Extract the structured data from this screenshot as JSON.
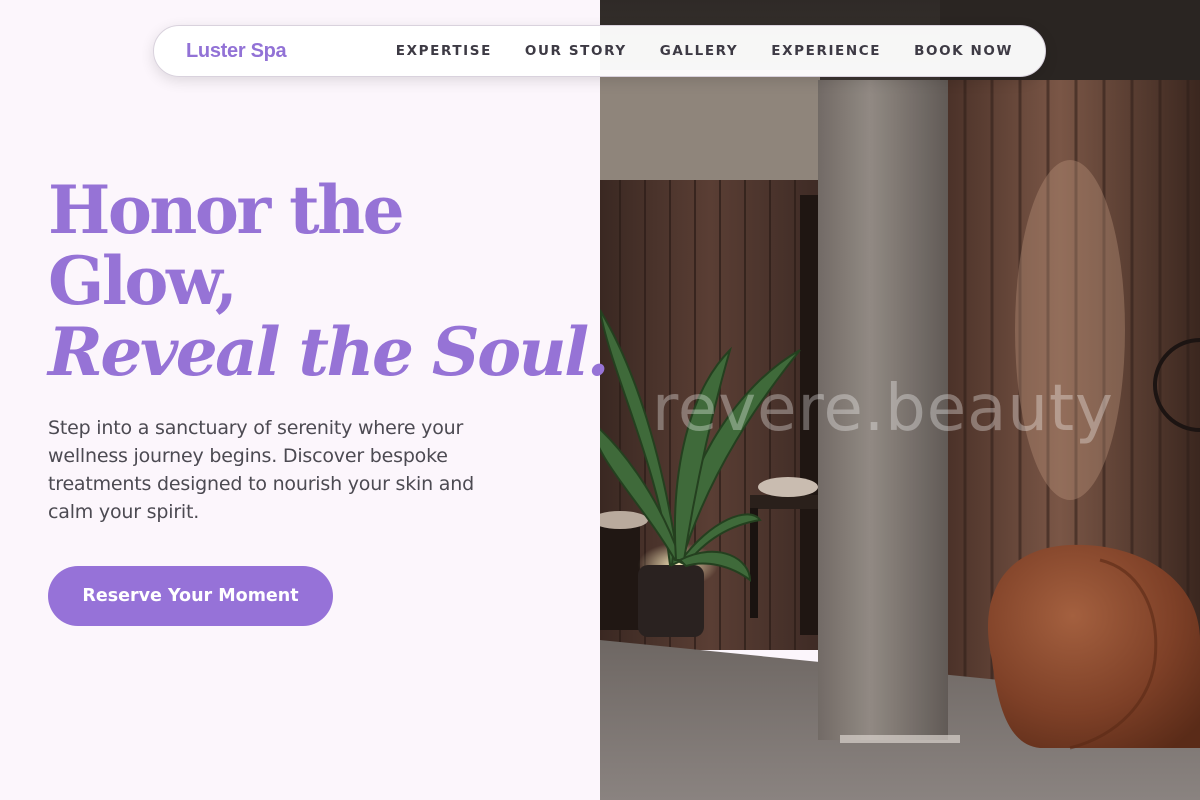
{
  "nav": {
    "brand": "Luster Spa",
    "links": [
      "EXPERTISE",
      "OUR STORY",
      "GALLERY",
      "EXPERIENCE",
      "BOOK NOW"
    ]
  },
  "hero": {
    "title_line1": "Honor the",
    "title_line2": "Glow,",
    "title_line3": "Reveal the Soul.",
    "description": "Step into a sanctuary of serenity where your wellness journey begins. Discover bespoke treatments designed to nourish your skin and calm your spirit.",
    "cta_label": "Reserve Your Moment"
  },
  "photo": {
    "watermark": "revere.beauty"
  },
  "colors": {
    "accent": "#9672d8",
    "background": "#fcf6fc",
    "text": "#4c4a52"
  }
}
